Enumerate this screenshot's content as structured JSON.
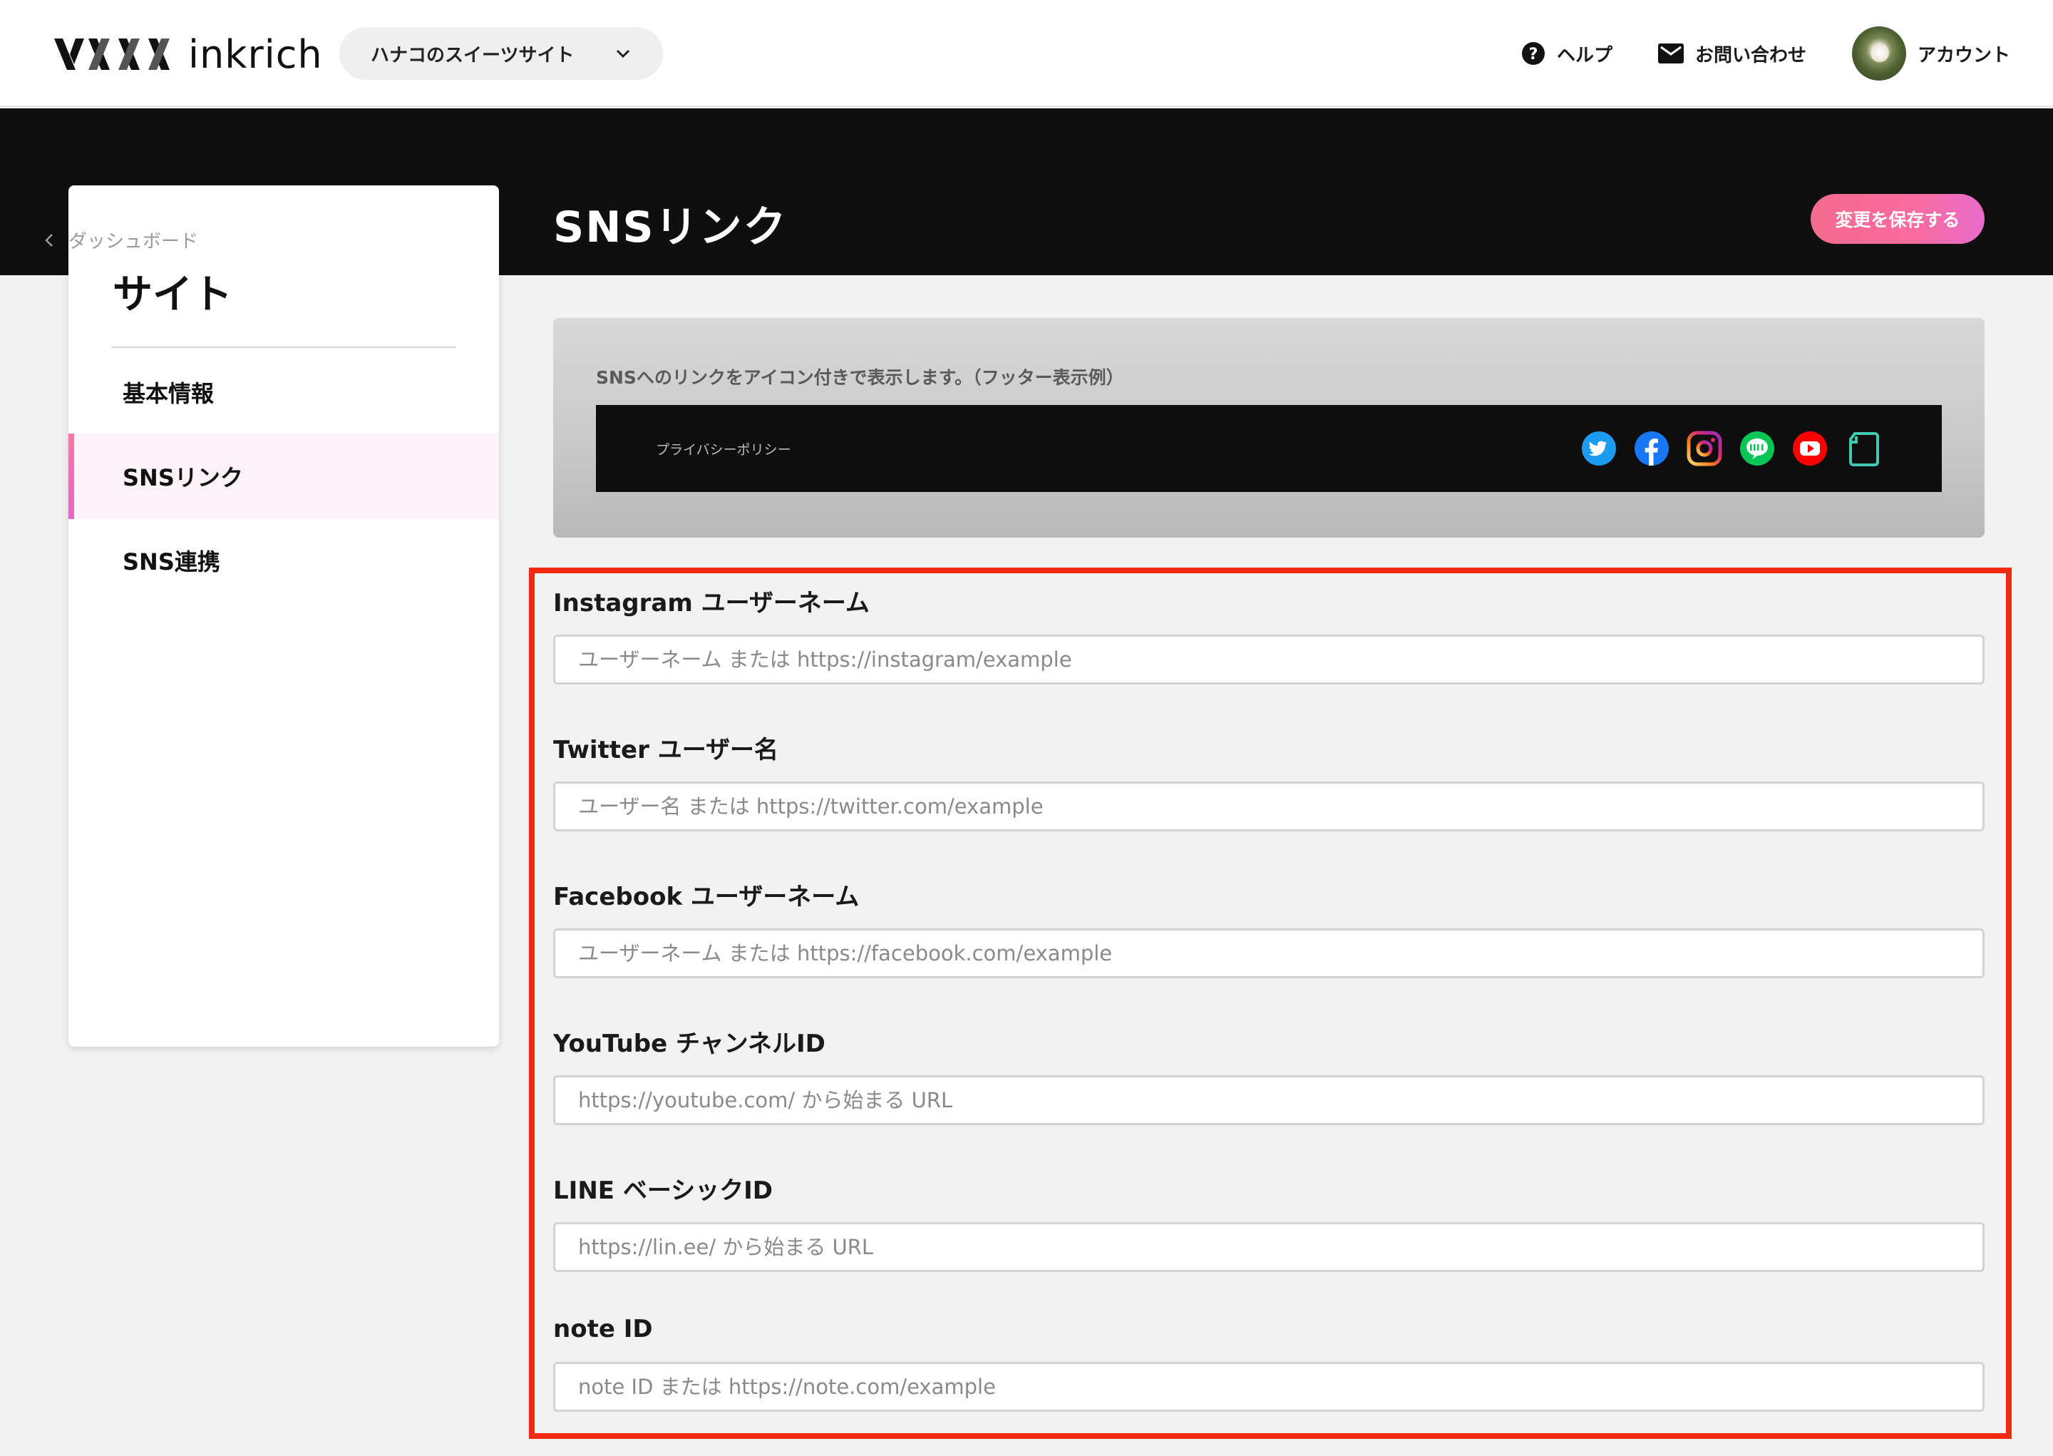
{
  "header": {
    "logo_text": "inkrich",
    "site_selector": {
      "label": "ハナコのスイーツサイト"
    },
    "nav": {
      "help": "ヘルプ",
      "contact": "お問い合わせ",
      "account": "アカウント"
    }
  },
  "page": {
    "title": "SNSリンク",
    "save_button": "変更を保存する"
  },
  "sidebar": {
    "back_label": "ダッシュボード",
    "title": "サイト",
    "items": [
      {
        "label": "基本情報",
        "active": false
      },
      {
        "label": "SNSリンク",
        "active": true
      },
      {
        "label": "SNS連携",
        "active": false
      }
    ]
  },
  "preview": {
    "caption": "SNSへのリンクをアイコン付きで表示します。（フッター表示例）",
    "footer_link": "プライバシーポリシー",
    "icons": [
      {
        "name": "twitter-icon",
        "color": "#1d9bf0"
      },
      {
        "name": "facebook-icon",
        "color": "#1877f2"
      },
      {
        "name": "instagram-icon",
        "color": "#e1306c"
      },
      {
        "name": "line-icon",
        "color": "#06c755"
      },
      {
        "name": "youtube-icon",
        "color": "#ff0000"
      },
      {
        "name": "note-icon",
        "color": "#41c9b4"
      }
    ]
  },
  "form": {
    "fields": [
      {
        "label": "Instagram ユーザーネーム",
        "placeholder": "ユーザーネーム または https://instagram/example",
        "value": ""
      },
      {
        "label": "Twitter ユーザー名",
        "placeholder": "ユーザー名 または https://twitter.com/example",
        "value": ""
      },
      {
        "label": "Facebook ユーザーネーム",
        "placeholder": "ユーザーネーム または https://facebook.com/example",
        "value": ""
      },
      {
        "label": "YouTube チャンネルID",
        "placeholder": "https://youtube.com/ から始まる URL",
        "value": ""
      },
      {
        "label": "LINE ベーシックID",
        "placeholder": "https://lin.ee/ から始まる URL",
        "value": ""
      },
      {
        "label": "note ID",
        "placeholder": "note ID または https://note.com/example",
        "value": ""
      }
    ]
  },
  "colors": {
    "accent_gradient_start": "#f46b8f",
    "accent_gradient_end": "#e86ccc",
    "highlight_border": "#f22a12",
    "header_band": "#0f0f0f"
  }
}
